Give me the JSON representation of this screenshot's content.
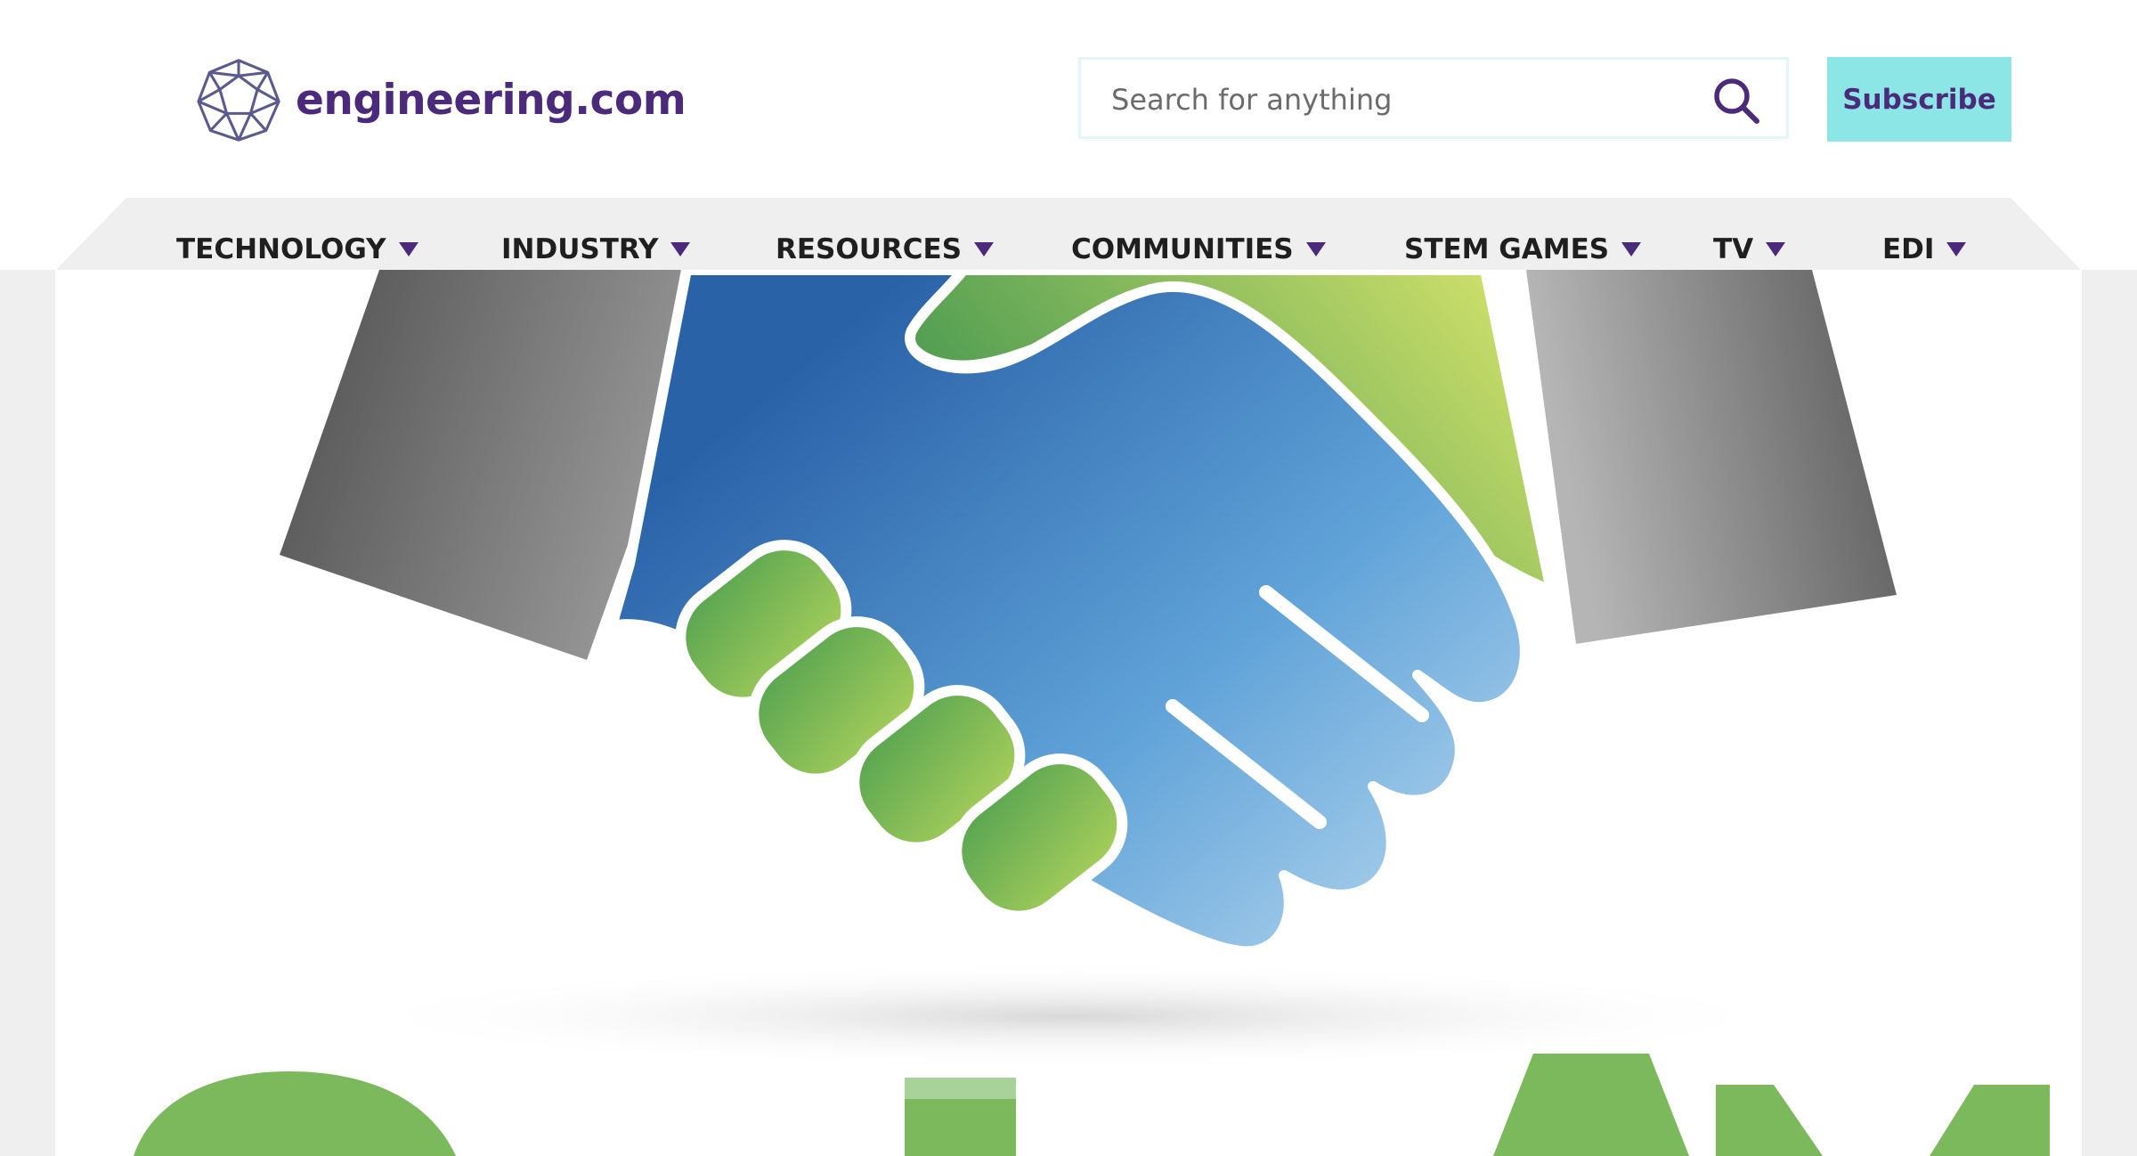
{
  "site": {
    "name": "engineering.com"
  },
  "search": {
    "placeholder": "Search for anything"
  },
  "header": {
    "subscribe_label": "Subscribe"
  },
  "nav": {
    "items": [
      {
        "label": "TECHNOLOGY"
      },
      {
        "label": "INDUSTRY"
      },
      {
        "label": "RESOURCES"
      },
      {
        "label": "COMMUNITIES"
      },
      {
        "label": "STEM GAMES"
      },
      {
        "label": "TV"
      },
      {
        "label": "EDI"
      }
    ]
  },
  "icons": {
    "logo": "geodesic-sphere-icon",
    "search": "search-icon",
    "caret": "caret-down-icon"
  },
  "colors": {
    "brand_purple": "#4b2a7b",
    "subscribe_bg": "#8de6e6",
    "nav_bg": "#efefef",
    "hero_green": "#7cb95d",
    "hero_blue": "#3b7dc0",
    "sleeve_gray": "#6b6b6b"
  }
}
